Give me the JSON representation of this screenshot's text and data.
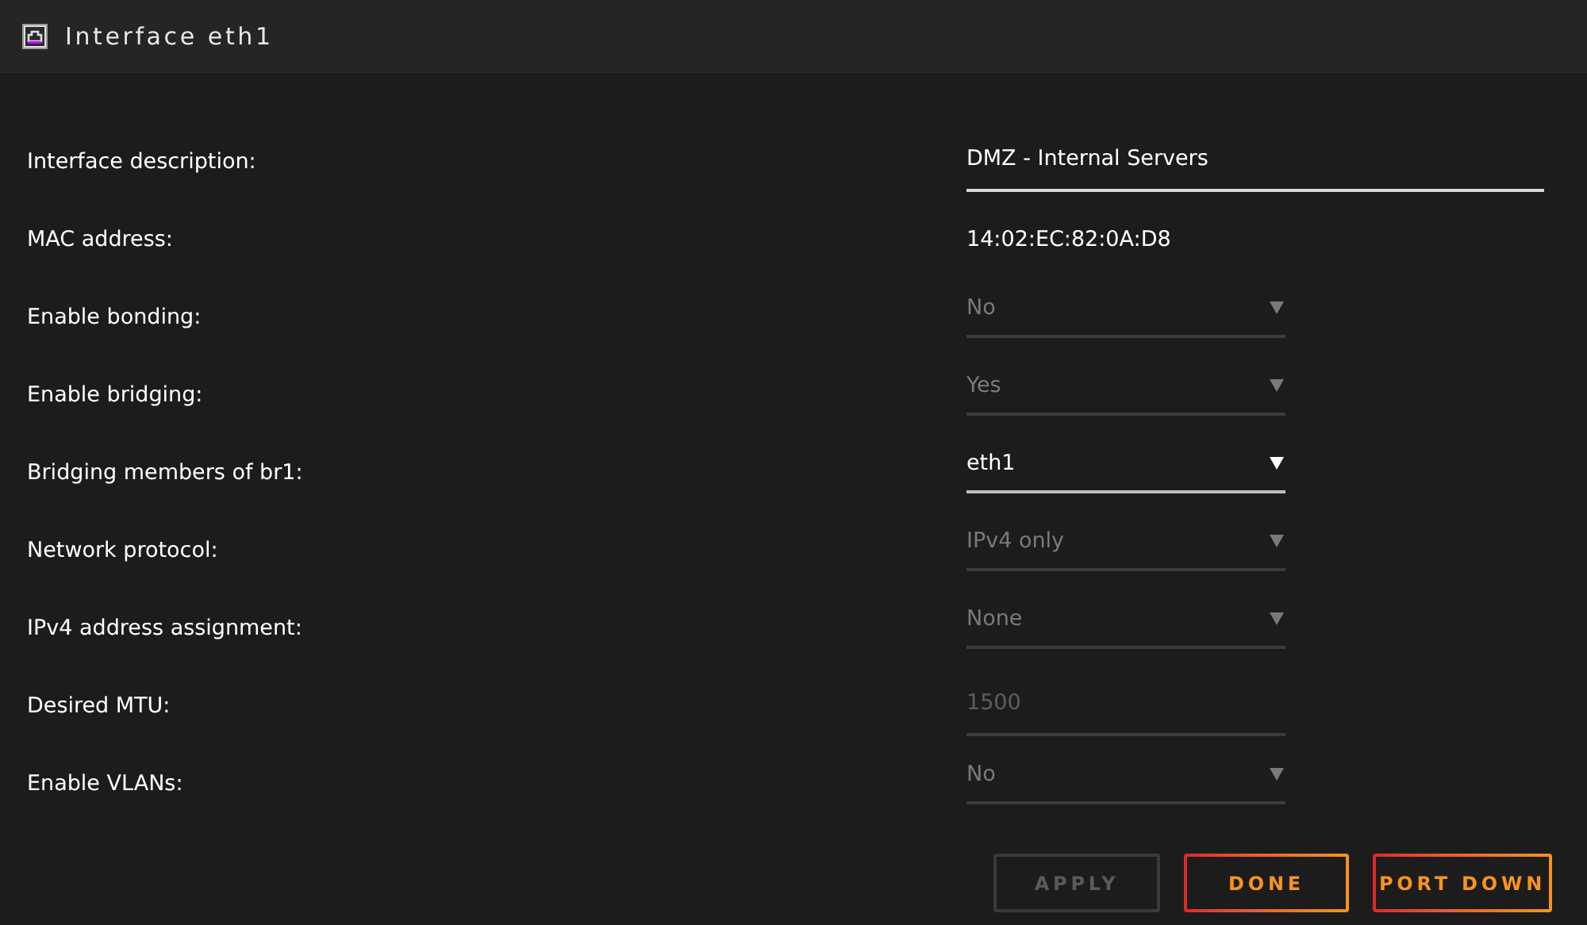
{
  "window": {
    "title": "Interface eth1"
  },
  "fields": [
    {
      "kind": "text",
      "label": "Interface description:",
      "value": "DMZ - Internal Servers",
      "disabled": false
    },
    {
      "kind": "static",
      "label": "MAC address:",
      "value": "14:02:EC:82:0A:D8"
    },
    {
      "kind": "select",
      "label": "Enable bonding:",
      "value": "No",
      "disabled": true
    },
    {
      "kind": "select",
      "label": "Enable bridging:",
      "value": "Yes",
      "disabled": true
    },
    {
      "kind": "select",
      "label": "Bridging members of br1:",
      "value": "eth1",
      "disabled": false
    },
    {
      "kind": "select",
      "label": "Network protocol:",
      "value": "IPv4 only",
      "disabled": true
    },
    {
      "kind": "select",
      "label": "IPv4 address assignment:",
      "value": "None",
      "disabled": true
    },
    {
      "kind": "number",
      "label": "Desired MTU:",
      "placeholder": "1500",
      "disabled": true
    },
    {
      "kind": "select",
      "label": "Enable VLANs:",
      "value": "No",
      "disabled": true
    }
  ],
  "buttons": [
    {
      "label": "APPLY",
      "disabled": true
    },
    {
      "label": "DONE",
      "disabled": false
    },
    {
      "label": "PORT DOWN",
      "disabled": false
    }
  ]
}
